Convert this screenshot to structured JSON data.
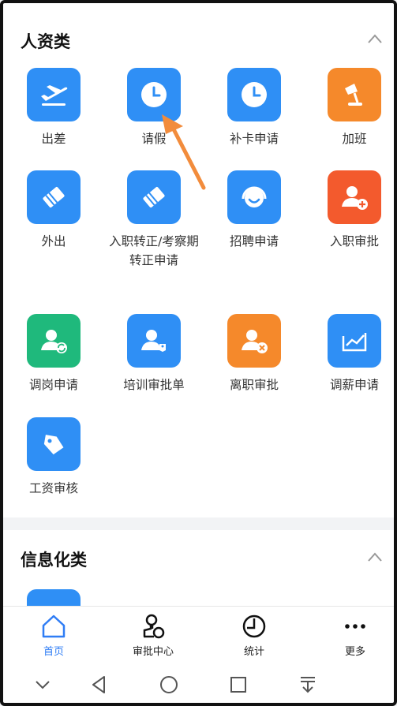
{
  "sections": {
    "hr": {
      "title": "人资类",
      "items": [
        {
          "label": "出差",
          "icon": "airplane-departure-icon",
          "color": "#2f8ff5"
        },
        {
          "label": "请假",
          "icon": "clock-icon",
          "color": "#2f8ff5"
        },
        {
          "label": "补卡申请",
          "icon": "clock-icon",
          "color": "#2f8ff5"
        },
        {
          "label": "加班",
          "icon": "desk-lamp-icon",
          "color": "#f5892b"
        },
        {
          "label": "外出",
          "icon": "eraser-icon",
          "color": "#2f8ff5"
        },
        {
          "label": "入职转正/考察期转正申请",
          "icon": "eraser-icon",
          "color": "#2f8ff5"
        },
        {
          "label": "招聘申请",
          "icon": "headset-smile-icon",
          "color": "#2f8ff5"
        },
        {
          "label": "入职审批",
          "icon": "user-add-icon",
          "color": "#f35a2d"
        },
        {
          "label": "调岗申请",
          "icon": "user-sync-icon",
          "color": "#1fb97c"
        },
        {
          "label": "培训审批单",
          "icon": "user-tag-icon",
          "color": "#2f8ff5"
        },
        {
          "label": "离职审批",
          "icon": "user-remove-icon",
          "color": "#f5892b"
        },
        {
          "label": "调薪申请",
          "icon": "trend-chart-icon",
          "color": "#2f8ff5"
        },
        {
          "label": "工资审核",
          "icon": "price-tag-icon",
          "color": "#2f8ff5"
        }
      ]
    },
    "info": {
      "title": "信息化类"
    }
  },
  "tabbar": [
    {
      "label": "首页",
      "icon": "home-icon",
      "active": true
    },
    {
      "label": "审批中心",
      "icon": "approval-center-icon",
      "active": false
    },
    {
      "label": "统计",
      "icon": "pie-chart-icon",
      "active": false
    },
    {
      "label": "更多",
      "icon": "more-dots-icon",
      "active": false
    }
  ],
  "colors": {
    "accent": "#2f7df5",
    "arrow": "#f28c3c"
  }
}
